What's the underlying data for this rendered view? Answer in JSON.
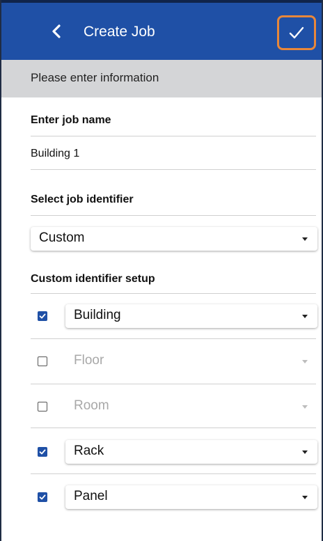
{
  "header": {
    "title": "Create Job",
    "back_icon": "chevron-left-icon",
    "confirm_icon": "checkmark-icon",
    "bar_color": "#1f50a6",
    "highlight_color": "#e8873a"
  },
  "info_bar": {
    "text": "Please enter information"
  },
  "job_name": {
    "label": "Enter job name",
    "value": "Building 1"
  },
  "job_identifier": {
    "label": "Select job identifier",
    "selected": "Custom"
  },
  "custom_setup": {
    "label": "Custom identifier setup",
    "items": [
      {
        "label": "Building",
        "checked": true
      },
      {
        "label": "Floor",
        "checked": false
      },
      {
        "label": "Room",
        "checked": false
      },
      {
        "label": "Rack",
        "checked": true
      },
      {
        "label": "Panel",
        "checked": true
      }
    ]
  }
}
